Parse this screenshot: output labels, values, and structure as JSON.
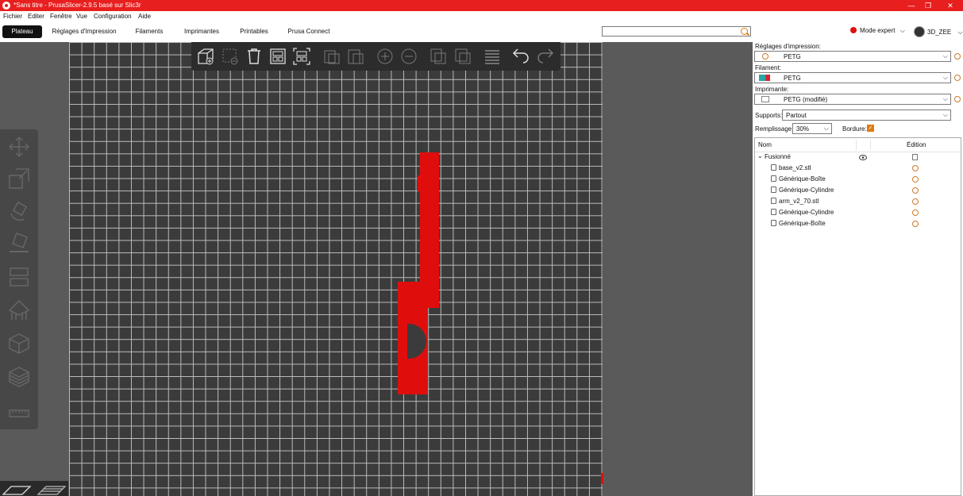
{
  "window": {
    "title": "*Sans titre - PrusaSlicer-2.9.5 basé sur Slic3r",
    "controls": [
      "—",
      "❐",
      "✕"
    ]
  },
  "menu": [
    "Fichier",
    "Editer",
    "Fenêtre",
    "Vue",
    "Configuration",
    "Aide"
  ],
  "tabs": [
    {
      "label": "Plateau",
      "active": true
    },
    {
      "label": "Réglages d'Impression",
      "active": false
    },
    {
      "label": "Filaments",
      "active": false
    },
    {
      "label": "Imprimantes",
      "active": false
    },
    {
      "label": "Printables",
      "active": false
    },
    {
      "label": "Prusa Connect",
      "active": false
    }
  ],
  "search": {
    "placeholder": "",
    "icon": "search-icon"
  },
  "mode": {
    "label": "Mode expert",
    "color": "#e01010"
  },
  "user": {
    "name": "3D_ZEE"
  },
  "right_panel": {
    "print_settings": {
      "label": "Réglages d'impression:",
      "value": "PETG"
    },
    "filament": {
      "label": "Filament:",
      "value": "PETG",
      "swatch_colors": [
        "#27a6a6",
        "#e0202a"
      ]
    },
    "printer": {
      "label": "Imprimante:",
      "value": "PETG (modifié)"
    },
    "supports": {
      "label": "Supports:",
      "value": "Partout"
    },
    "infill": {
      "label": "Remplissage:",
      "value": "30%"
    },
    "brim": {
      "label": "Bordure:",
      "checked": true
    },
    "object_list": {
      "col_name": "Nom",
      "col_edit": "Édition",
      "group": "Fusionné",
      "items": [
        "base_v2.stl",
        "Générique-Boîte",
        "Générique-Cylindre",
        "arm_v2_70.stl",
        "Générique-Cylindre",
        "Générique-Boîte"
      ]
    }
  },
  "colors": {
    "accent": "#e07a10",
    "titlebar": "#e81f1f",
    "model": "#e00d0d"
  }
}
